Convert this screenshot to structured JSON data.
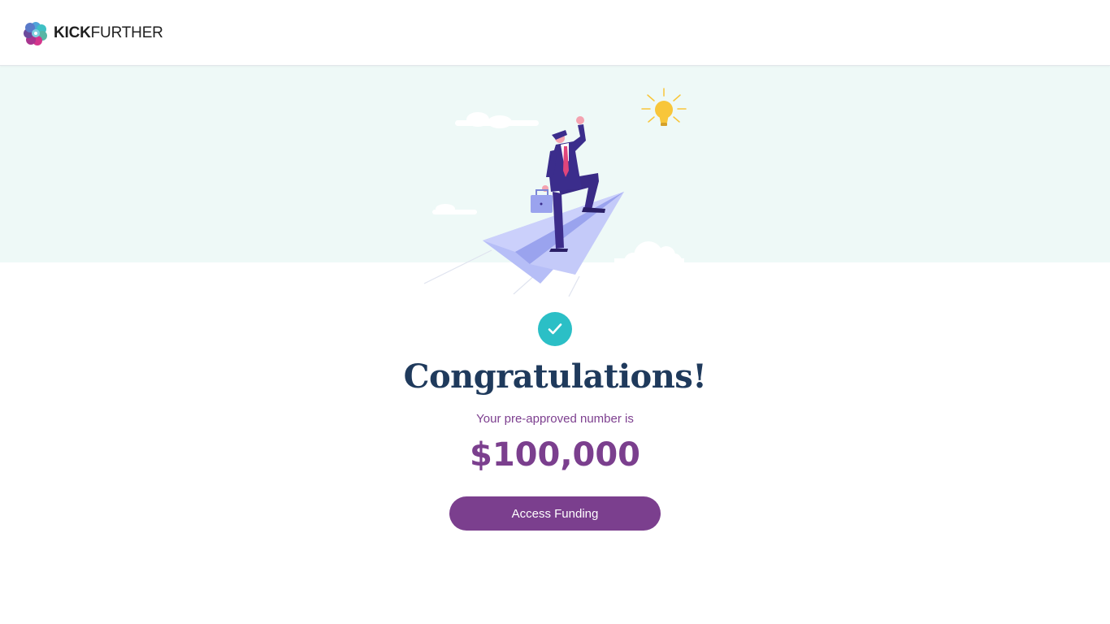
{
  "brand": {
    "name_bold": "KICK",
    "name_light": "FURTHER",
    "logo_icon": "kickfurther-flower-icon"
  },
  "hero": {
    "illustration": "businessman-on-paper-plane-illustration",
    "badge_icon": "checkmark-icon"
  },
  "main": {
    "title": "Congratulations!",
    "subtitle": "Your pre-approved number is",
    "amount": "$100,000",
    "cta_label": "Access Funding"
  },
  "colors": {
    "primary_purple": "#7b3f8e",
    "navy": "#1f3a5c",
    "teal": "#2bbfc6",
    "hero_background": "#eef9f7"
  }
}
